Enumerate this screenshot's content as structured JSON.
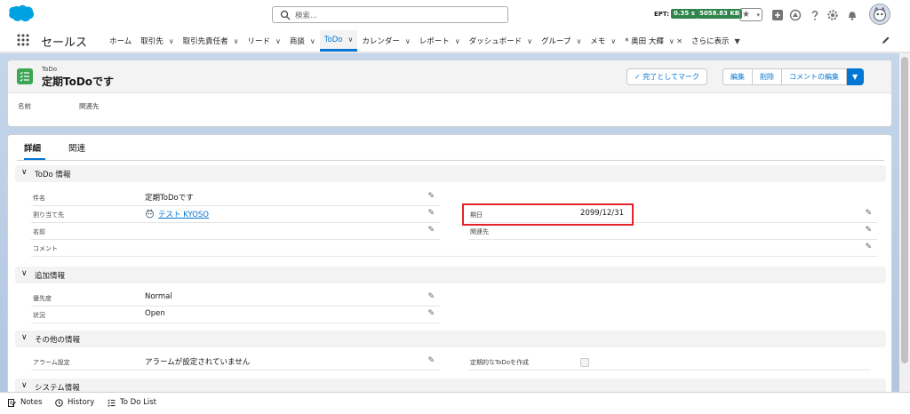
{
  "header": {
    "search_placeholder": "検索...",
    "ept_label": "EPT:",
    "ept_time": "0.35 s",
    "ept_size": "5058.83 KB",
    "star": "★",
    "chev": "▾"
  },
  "nav": {
    "app_name": "セールス",
    "items": [
      {
        "label": "ホーム",
        "chevron": ""
      },
      {
        "label": "取引先",
        "chevron": "∨"
      },
      {
        "label": "取引先責任者",
        "chevron": "∨"
      },
      {
        "label": "リード",
        "chevron": "∨"
      },
      {
        "label": "商談",
        "chevron": "∨"
      },
      {
        "label": "ToDo",
        "chevron": "∨"
      },
      {
        "label": "カレンダー",
        "chevron": "∨"
      },
      {
        "label": "レポート",
        "chevron": "∨"
      },
      {
        "label": "ダッシュボード",
        "chevron": "∨"
      },
      {
        "label": "グループ",
        "chevron": "∨"
      },
      {
        "label": "メモ",
        "chevron": "∨"
      },
      {
        "label": "* 奥田 大輝",
        "chevron": "∨ ✕"
      },
      {
        "label": "さらに表示",
        "chevron": "▼"
      }
    ]
  },
  "record": {
    "object_type": "ToDo",
    "title": "定期ToDoです",
    "buttons": {
      "mark_complete": "✓ 完了としてマーク",
      "edit": "編集",
      "delete": "削除",
      "edit_comment": "コメントの編集",
      "dropdown": "▼"
    },
    "highlights": {
      "name_label": "名前",
      "related_label": "関連先"
    }
  },
  "tabs": {
    "details": "詳細",
    "related": "関連"
  },
  "sections": {
    "todo_info": "ToDo 情報",
    "additional": "追加情報",
    "other": "その他の情報",
    "system": "システム情報"
  },
  "fields": {
    "subject_label": "件名",
    "subject_value": "定期ToDoです",
    "assigned_label": "割り当て先",
    "assigned_value": "テスト KYOSO",
    "name_label": "名前",
    "comment_label": "コメント",
    "due_label": "期日",
    "due_value": "2099/12/31",
    "related_label": "関連先",
    "priority_label": "優先度",
    "priority_value": "Normal",
    "status_label": "状況",
    "status_value": "Open",
    "alarm_label": "アラーム設定",
    "alarm_value": "アラームが設定されていません",
    "recurring_label": "定期的なToDoを作成"
  },
  "utility": {
    "notes": "Notes",
    "history": "History",
    "todo_list": "To Do List"
  },
  "colors": {
    "brand": "#0176d3",
    "highlight_box": "#e3242b",
    "badge": "#2e844a"
  }
}
